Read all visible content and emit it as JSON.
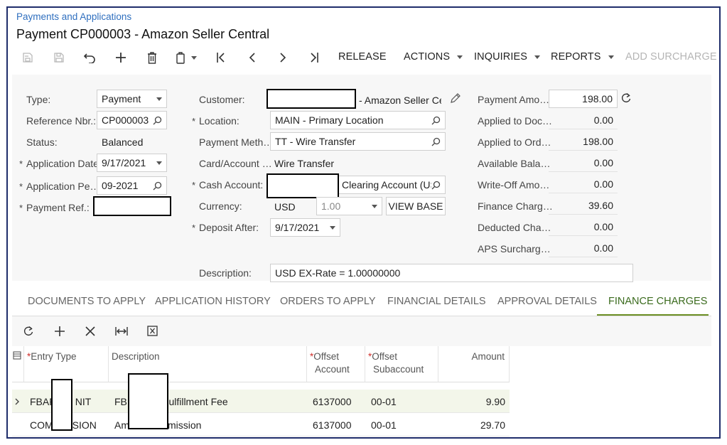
{
  "header": {
    "breadcrumb": "Payments and Applications",
    "title": "Payment CP000003 - Amazon Seller Central"
  },
  "toolbar": {
    "release": "RELEASE",
    "actions": "ACTIONS",
    "inquiries": "INQUIRIES",
    "reports": "REPORTS",
    "add_surcharge": "ADD SURCHARGE"
  },
  "form": {
    "type_label": "Type:",
    "type_value": "Payment",
    "refnbr_label": "Reference Nbr.:",
    "refnbr_value": "CP000003",
    "status_label": "Status:",
    "status_value": "Balanced",
    "appdate_label": "Application Date:",
    "appdate_value": "9/17/2021",
    "appperiod_label": "Application Pe…",
    "appperiod_value": "09-2021",
    "payref_label": "Payment Ref.:",
    "customer_label": "Customer:",
    "customer_value": "- Amazon Seller Cent",
    "location_label": "Location:",
    "location_value": "MAIN - Primary Location",
    "paymethod_label": "Payment Meth…",
    "paymethod_value": "TT - Wire Transfer",
    "cardaccount_label": "Card/Account …",
    "cardaccount_value": "Wire Transfer",
    "cashaccount_label": "Cash Account:",
    "cashaccount_value": "Clearing Account (US",
    "currency_label": "Currency:",
    "currency_value": "USD",
    "rate_value": "1.00",
    "viewbase": "VIEW BASE",
    "depositafter_label": "Deposit After:",
    "depositafter_value": "9/17/2021",
    "description_label": "Description:",
    "description_value": "USD EX-Rate = 1.00000000",
    "required_mark": "*"
  },
  "amounts": [
    {
      "label": "Payment Amo…",
      "value": "198.00"
    },
    {
      "label": "Applied to Doc…",
      "value": "0.00"
    },
    {
      "label": "Applied to Ord…",
      "value": "198.00"
    },
    {
      "label": "Available Bala…",
      "value": "0.00"
    },
    {
      "label": "Write-Off Amo…",
      "value": "0.00"
    },
    {
      "label": "Finance Charg…",
      "value": "39.60"
    },
    {
      "label": "Deducted Cha…",
      "value": "0.00"
    },
    {
      "label": "APS Surcharg…",
      "value": "0.00"
    }
  ],
  "tabs": [
    {
      "label": "DOCUMENTS TO APPLY"
    },
    {
      "label": "APPLICATION HISTORY"
    },
    {
      "label": "ORDERS TO APPLY"
    },
    {
      "label": "FINANCIAL DETAILS"
    },
    {
      "label": "APPROVAL DETAILS"
    },
    {
      "label": "FINANCE CHARGES"
    }
  ],
  "grid": {
    "headers": {
      "entry_type": "Entry Type",
      "description": "Description",
      "offset_account_1": "Offset",
      "offset_account_2": "Account",
      "offset_sub_1": "Offset",
      "offset_sub_2": "Subaccount",
      "amount": "Amount"
    },
    "rows": [
      {
        "entry_type_a": "FBAF",
        "entry_type_b": "NIT",
        "desc_a": "FB",
        "desc_b": "Fulfillment Fee",
        "account": "6137000",
        "sub": "00-01",
        "amount": "9.90"
      },
      {
        "entry_type_a": "COM",
        "entry_type_b": "SION",
        "desc_a": "Am",
        "desc_b": "mission",
        "account": "6137000",
        "sub": "00-01",
        "amount": "29.70"
      }
    ]
  },
  "colors": {
    "accent_tab": "#6b8e23",
    "link": "#2f6fbf",
    "frame_border": "#1f2d6b"
  }
}
